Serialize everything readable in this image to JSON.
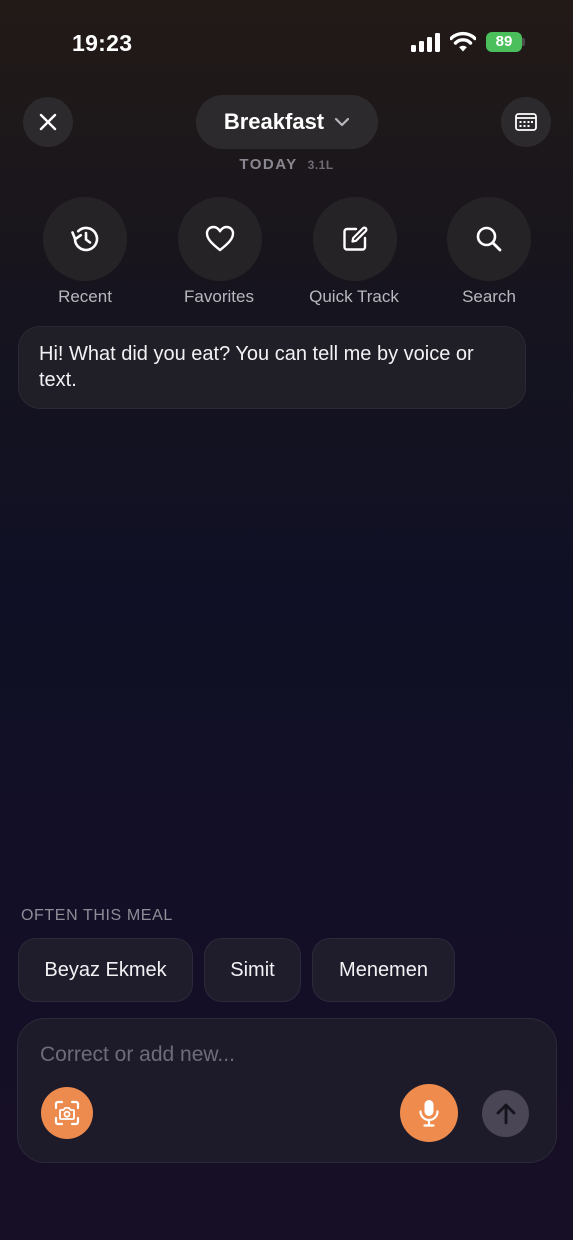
{
  "status_bar": {
    "time": "19:23",
    "battery_level": "89",
    "icons": [
      "signal-icon",
      "wifi-icon",
      "battery-icon"
    ],
    "battery_color": "#4bbf5c"
  },
  "header": {
    "meal": "Breakfast",
    "date_label": "TODAY",
    "water_value": "3.1L",
    "icons": [
      "close-icon",
      "chevron-down-icon",
      "calendar-icon"
    ]
  },
  "quick_actions": [
    {
      "label": "Recent",
      "icon": "history-icon"
    },
    {
      "label": "Favorites",
      "icon": "heart-icon"
    },
    {
      "label": "Quick Track",
      "icon": "edit-icon"
    },
    {
      "label": "Search",
      "icon": "search-icon"
    }
  ],
  "chat": {
    "assistant_message": "Hi! What did you eat? You can tell me by voice or text."
  },
  "often": {
    "title": "OFTEN THIS MEAL",
    "items": [
      "Beyaz Ekmek",
      "Simit",
      "Menemen"
    ]
  },
  "composer": {
    "placeholder": "Correct or add new...",
    "value": "",
    "icons": [
      "camera-scan-icon",
      "microphone-icon",
      "arrow-up-icon"
    ],
    "accent_color": "#ef8b4d"
  }
}
